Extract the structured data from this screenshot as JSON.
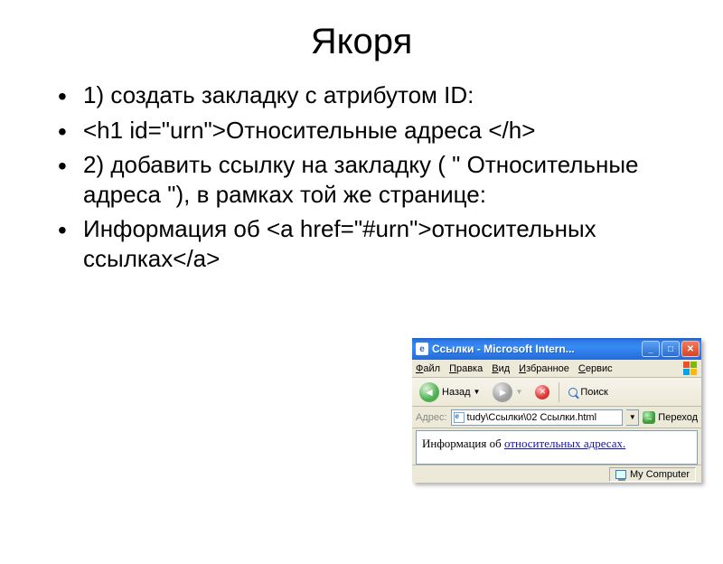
{
  "title": "Якоря",
  "bullets": {
    "b1": "1) создать закладку с атрибутом ID:",
    "b2": "<h1 id=\"urn\">Относительные адреса </h>",
    "b3": "2) добавить ссылку на закладку ( \" Относительные адреса \"), в рамках той же странице:",
    "b4": "Информация об <a href=\"#urn\">относительных ссылках</a>"
  },
  "browser": {
    "title": "Ссылки - Microsoft Intern...",
    "menu": {
      "file": "Файл",
      "edit": "Правка",
      "view": "Вид",
      "favorites": "Избранное",
      "service": "Сервис"
    },
    "toolbar": {
      "back": "Назад",
      "search": "Поиск"
    },
    "address": {
      "label": "Адрес:",
      "value": "tudy\\Ссылки\\02 Ссылки.html",
      "go": "Переход"
    },
    "page": {
      "prefix": "Информация об ",
      "link": "относительных адресах.",
      "link_href": "#urn"
    },
    "status": {
      "text": "My Computer"
    }
  }
}
